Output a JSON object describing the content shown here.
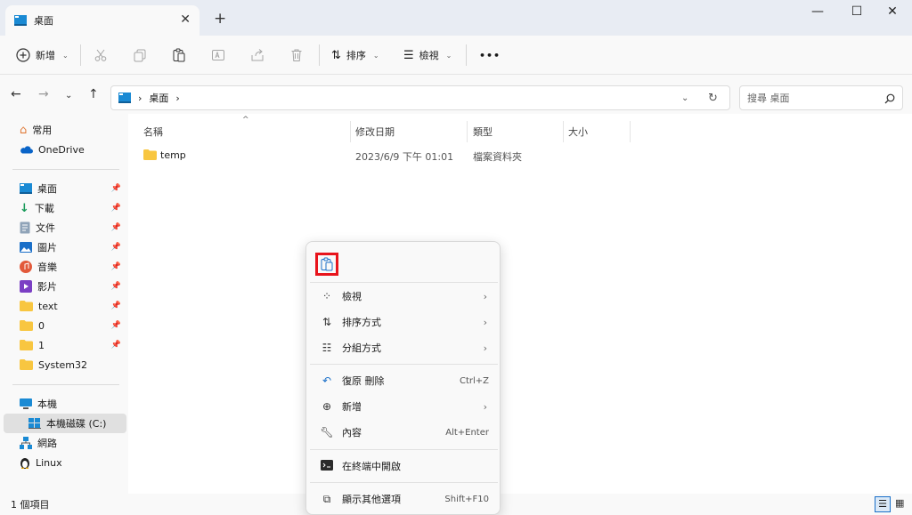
{
  "window": {
    "tab_title": "桌面",
    "tab_close": "✕",
    "new_tab": "+",
    "minimize": "—",
    "maximize": "☐",
    "close": "✕"
  },
  "toolbar": {
    "new_label": "新增",
    "sort_label": "排序",
    "view_label": "檢視",
    "more_label": "•••"
  },
  "address": {
    "path": "桌面",
    "search_placeholder": "搜尋 桌面"
  },
  "sidebar": {
    "items": [
      {
        "label": "常用"
      },
      {
        "label": "OneDrive"
      },
      {
        "label": "桌面"
      },
      {
        "label": "下載"
      },
      {
        "label": "文件"
      },
      {
        "label": "圖片"
      },
      {
        "label": "音樂"
      },
      {
        "label": "影片"
      },
      {
        "label": "text"
      },
      {
        "label": "0"
      },
      {
        "label": "1"
      },
      {
        "label": "System32"
      },
      {
        "label": "本機"
      },
      {
        "label": "本機磁碟 (C:)"
      },
      {
        "label": "網路"
      },
      {
        "label": "Linux"
      }
    ]
  },
  "file_list": {
    "columns": [
      "名稱",
      "修改日期",
      "類型",
      "大小"
    ],
    "rows": [
      {
        "name": "temp",
        "modified": "2023/6/9 下午 01:01",
        "type": "檔案資料夾",
        "size": ""
      }
    ]
  },
  "context_menu": {
    "items": [
      {
        "label": "檢視",
        "shortcut": "",
        "submenu": true
      },
      {
        "label": "排序方式",
        "shortcut": "",
        "submenu": true
      },
      {
        "label": "分組方式",
        "shortcut": "",
        "submenu": true
      },
      {
        "label": "復原 刪除",
        "shortcut": "Ctrl+Z",
        "submenu": false
      },
      {
        "label": "新增",
        "shortcut": "",
        "submenu": true
      },
      {
        "label": "內容",
        "shortcut": "Alt+Enter",
        "submenu": false
      },
      {
        "label": "在終端中開啟",
        "shortcut": "",
        "submenu": false
      },
      {
        "label": "顯示其他選項",
        "shortcut": "Shift+F10",
        "submenu": false
      }
    ]
  },
  "status": {
    "item_count": "1 個項目"
  },
  "colors": {
    "highlight_border": "#e8141c",
    "folder": "#f8c640",
    "accent": "#0a64c8"
  },
  "icons": {
    "paste": "paste-icon",
    "cut": "cut-icon",
    "copy": "copy-icon",
    "rename": "rename-icon",
    "share": "share-icon",
    "delete": "delete-icon",
    "folder": "folder-icon",
    "pin": "pin-icon"
  }
}
